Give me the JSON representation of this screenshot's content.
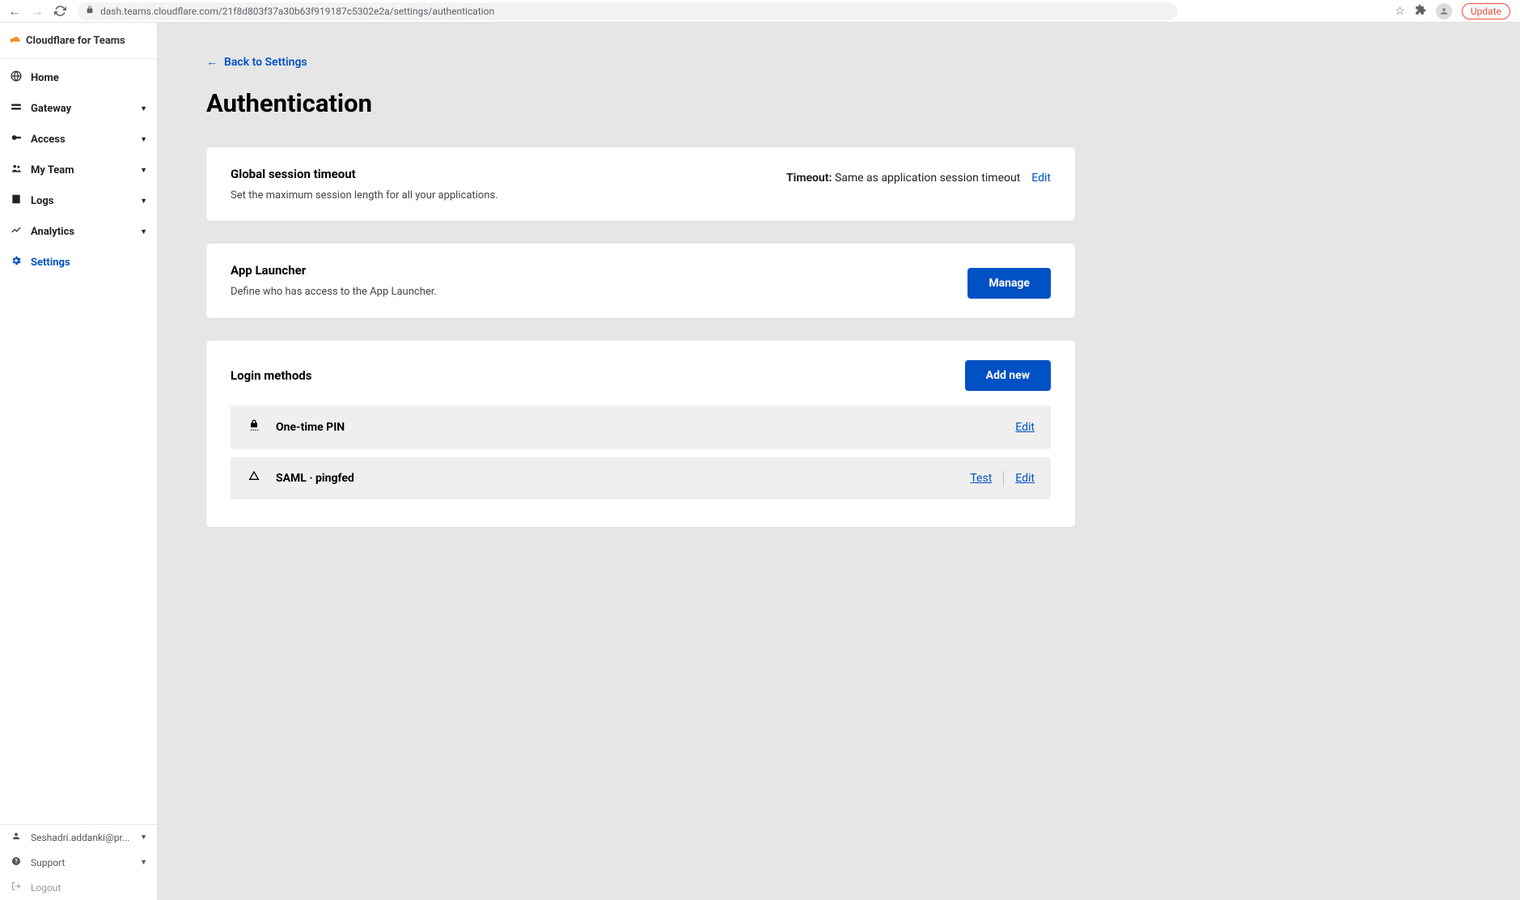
{
  "browser": {
    "url": "dash.teams.cloudflare.com/21f8d803f37a30b63f919187c5302e2a/settings/authentication",
    "update_label": "Update"
  },
  "sidebar": {
    "product_name": "Cloudflare for Teams",
    "items": [
      {
        "label": "Home",
        "icon": "home",
        "expandable": false
      },
      {
        "label": "Gateway",
        "icon": "gateway",
        "expandable": true
      },
      {
        "label": "Access",
        "icon": "access",
        "expandable": true
      },
      {
        "label": "My Team",
        "icon": "team",
        "expandable": true
      },
      {
        "label": "Logs",
        "icon": "logs",
        "expandable": true
      },
      {
        "label": "Analytics",
        "icon": "analytics",
        "expandable": true
      },
      {
        "label": "Settings",
        "icon": "settings",
        "expandable": false,
        "active": true
      }
    ],
    "footer": {
      "user_email": "Seshadri.addanki@pr...",
      "support_label": "Support",
      "logout_label": "Logout"
    }
  },
  "page": {
    "back_link": "Back to Settings",
    "title": "Authentication",
    "session_card": {
      "title": "Global session timeout",
      "description": "Set the maximum session length for all your applications.",
      "timeout_label": "Timeout:",
      "timeout_value": "Same as application session timeout",
      "edit_label": "Edit"
    },
    "launcher_card": {
      "title": "App Launcher",
      "description": "Define who has access to the App Launcher.",
      "button_label": "Manage"
    },
    "login_card": {
      "title": "Login methods",
      "add_button": "Add new",
      "methods": [
        {
          "name": "One-time PIN",
          "icon": "pin",
          "actions": [
            "Edit"
          ]
        },
        {
          "name": "SAML · pingfed",
          "icon": "saml",
          "actions": [
            "Test",
            "Edit"
          ]
        }
      ]
    }
  }
}
